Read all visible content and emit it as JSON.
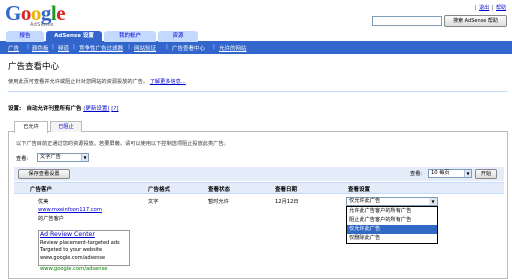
{
  "header": {
    "logo": {
      "G": "G",
      "o1": "o",
      "o2": "o",
      "g": "g",
      "l": "l",
      "e": "e"
    },
    "logo_sub": "AdSense",
    "top_links": [
      "|",
      "退出",
      "|",
      "帮助"
    ],
    "search_button": "搜索 AdSense 帮助"
  },
  "tabs": {
    "main": [
      "报告",
      "AdSense 设置",
      "我的帐户",
      "资源"
    ],
    "sub": [
      "广告",
      "|",
      "颜色板",
      "|",
      "频道",
      "|",
      "竞争性广告过滤器",
      "|",
      "网站验证",
      "|",
      "广告查看中心",
      "|",
      "允许的网站"
    ]
  },
  "page": {
    "title": "广告查看中心",
    "description": "使用此页可查看并允许或阻止针对您网站的资源投放的广告。",
    "learn_more": "了解更多信息..."
  },
  "setting": {
    "label": "设置:",
    "value": "自动允许刊登所有广告",
    "change_link": "(更新设置)",
    "help": "[?]"
  },
  "section_tabs": [
    "已允许",
    "已阻止"
  ],
  "panel": {
    "info": "以下广告目前正通过您的资源投放。若要屏蔽，请可以使用以下控制选项阻止投放此类广告。",
    "view_label": "查看:",
    "view_select": "文字广告",
    "save_button": "保存查看设置",
    "show_label": "查看:",
    "per_page_select": "10 每页",
    "go_button": "开始"
  },
  "table": {
    "headers": [
      "广告客户",
      "广告格式",
      "查看状态",
      "查看日期",
      "查看设置"
    ],
    "row": {
      "advertiser_name": "优美",
      "advertiser_url": "www.mxeinfoon117.com",
      "advertiser_desc": "的广告客户",
      "format": "文字",
      "status": "暂时允许",
      "date": "12月12日",
      "setting": "仅允许此广告"
    }
  },
  "dropdown_options": [
    "允许此广告客户的所有广告",
    "阻止此广告客户的所有广告",
    "仅允许此广告",
    "仅删除此广告"
  ],
  "dropdown_selected_index": 2,
  "ad_preview": {
    "title": "Ad Review Center",
    "line1": "Review placement-targeted ads",
    "line2": "Targeted to your website",
    "url": "www.google.com/adsense",
    "url_below": "www.google.com/adsense"
  }
}
